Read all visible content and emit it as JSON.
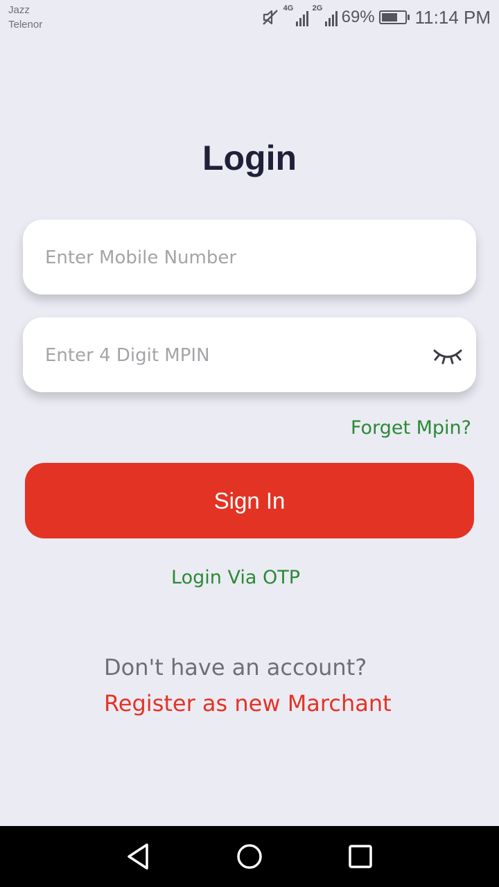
{
  "status_bar": {
    "carrier_1": "Jazz",
    "carrier_2": "Telenor",
    "network_1": "4G",
    "network_2": "2G",
    "battery_percent": "69%",
    "battery_level": 0.69,
    "time": "11:14 PM",
    "icons": [
      "mute-icon",
      "signal-icon",
      "signal-icon",
      "battery-icon"
    ]
  },
  "page": {
    "title": "Login"
  },
  "form": {
    "mobile_placeholder": "Enter Mobile Number",
    "mobile_value": "",
    "mpin_placeholder": "Enter 4 Digit MPIN",
    "mpin_value": "",
    "mpin_toggle_icon": "eye-closed-icon",
    "forget_label": "Forget Mpin?",
    "signin_label": "Sign In",
    "otp_label": "Login Via OTP"
  },
  "register": {
    "prompt": "Don't have an account?",
    "link_label": "Register as new Marchant"
  },
  "colors": {
    "background": "#ebebf4",
    "primary": "#e33324",
    "link_green": "#2a8a34",
    "title": "#20203a"
  },
  "nav": {
    "icons": [
      "back-icon",
      "home-icon",
      "recents-icon"
    ]
  }
}
